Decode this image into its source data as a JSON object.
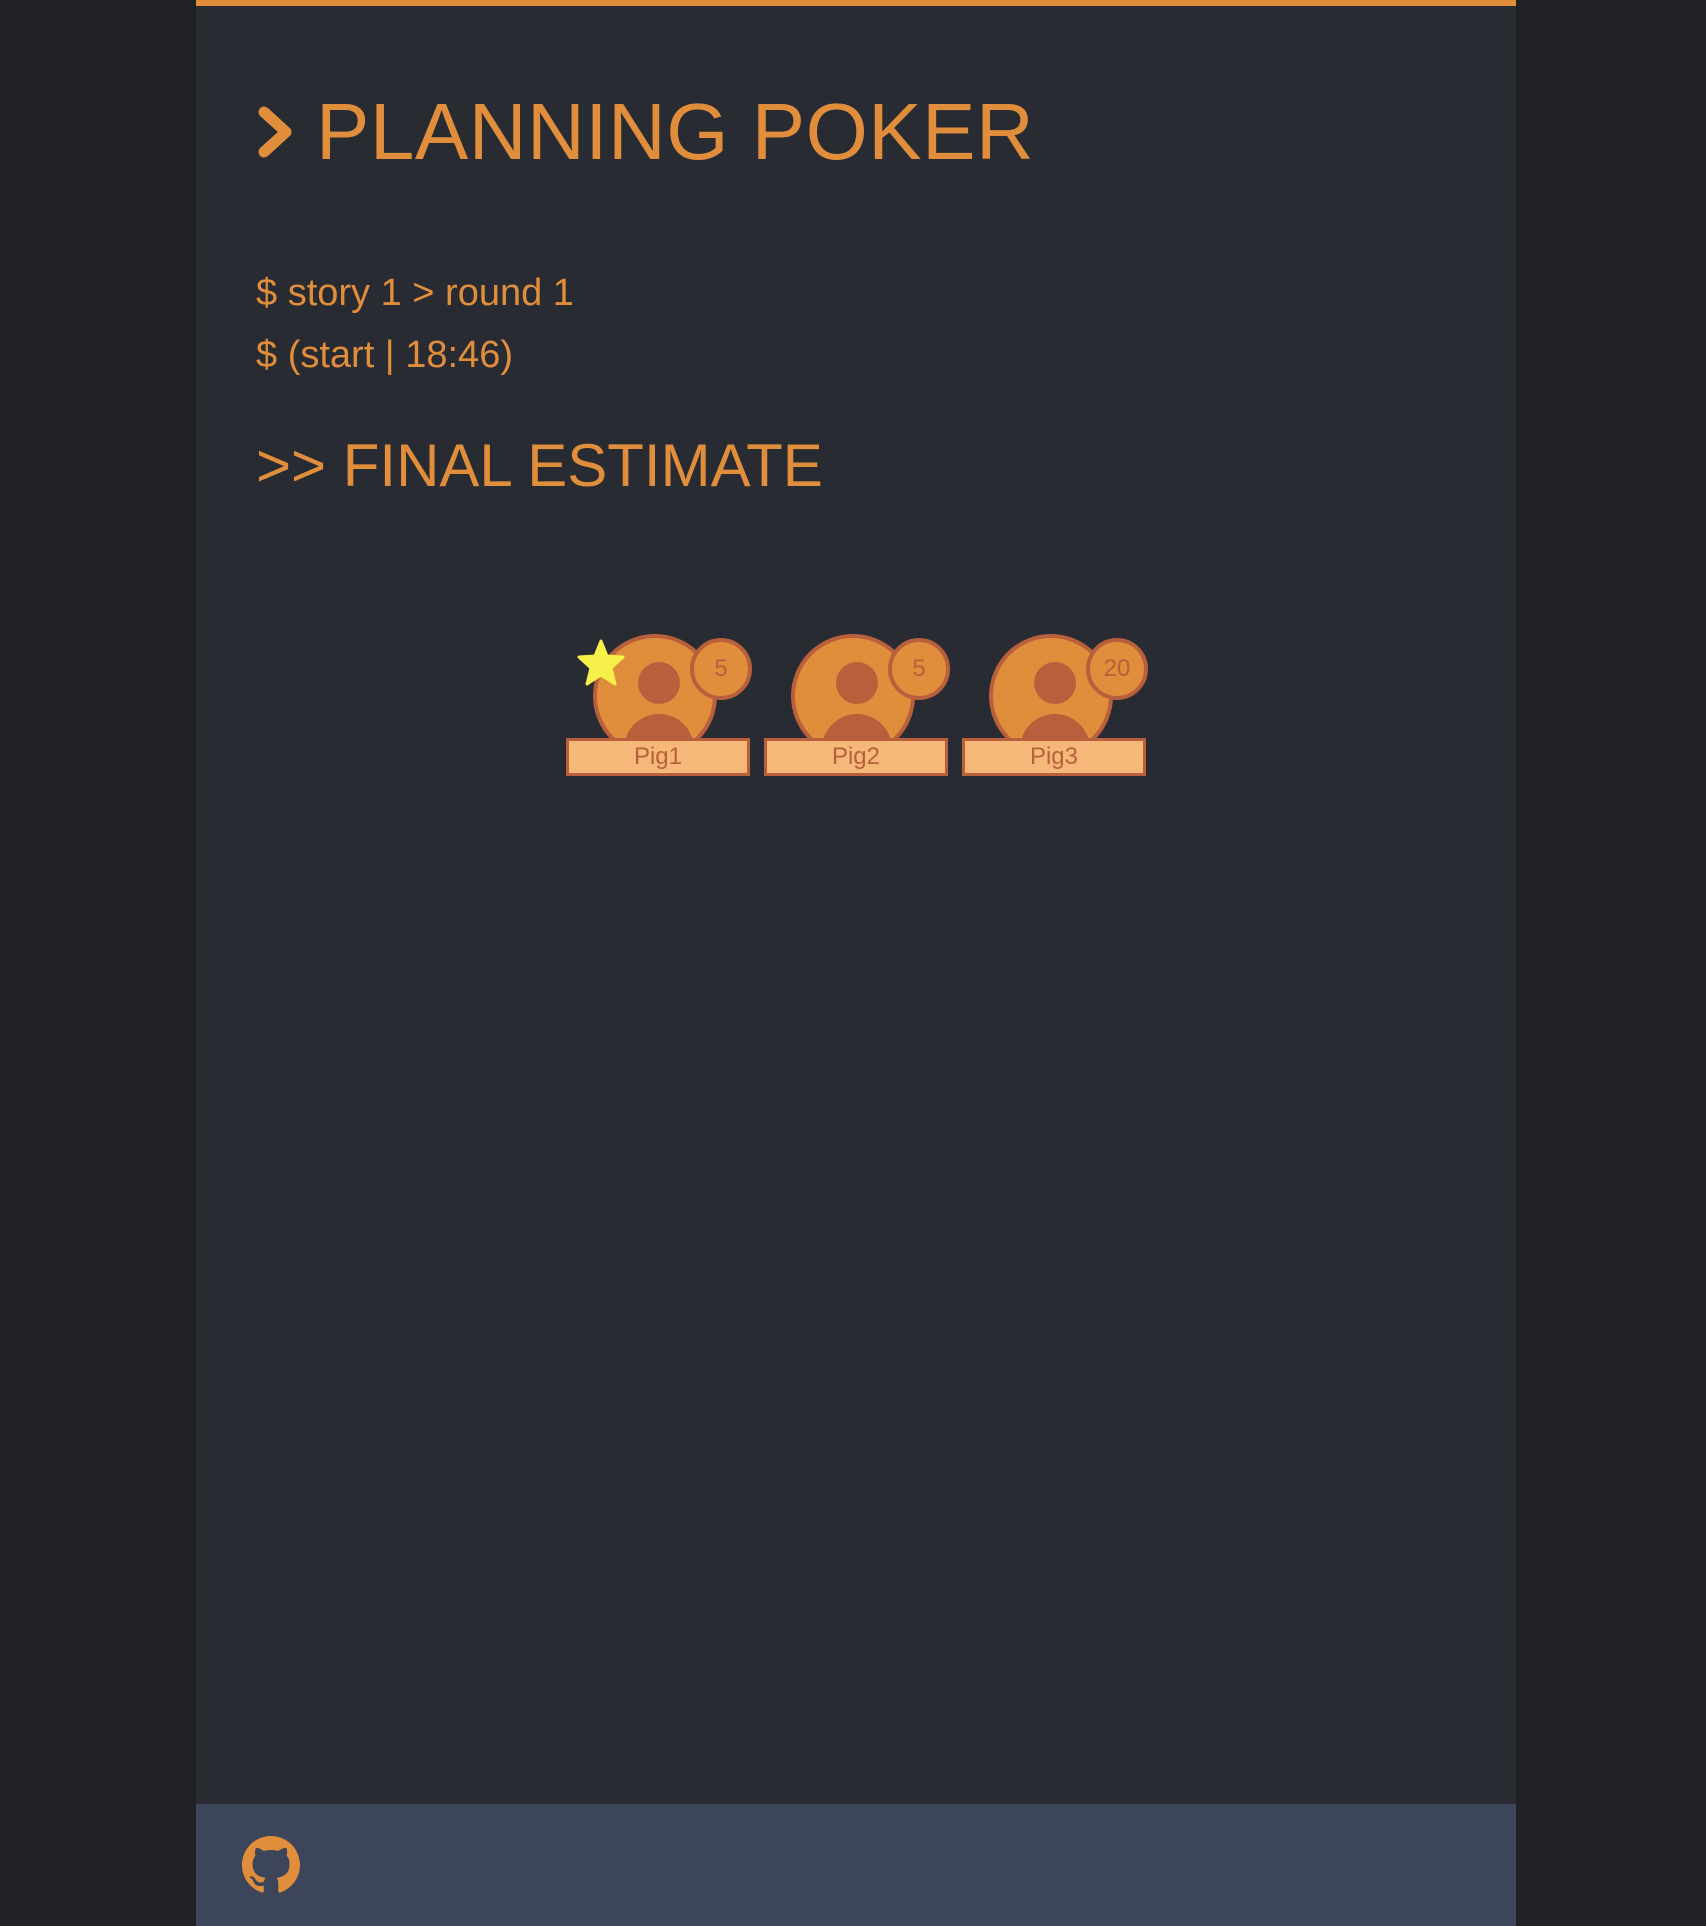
{
  "app": {
    "title": "PLANNING POKER"
  },
  "session": {
    "story_line": "$ story 1 > round 1",
    "status_line": "$ (start | 18:46)"
  },
  "estimate": {
    "heading": ">> FINAL ESTIMATE"
  },
  "players": [
    {
      "name": "Pig1",
      "vote": "5",
      "starred": true
    },
    {
      "name": "Pig2",
      "vote": "5",
      "starred": false
    },
    {
      "name": "Pig3",
      "vote": "20",
      "starred": false
    }
  ],
  "icons": {
    "header": "chevron-right-icon",
    "avatar": "user-icon",
    "highlight": "star-icon",
    "footer": "github-icon"
  },
  "colors": {
    "accent": "#e08d3c",
    "accent_dark": "#b8603c",
    "name_plate": "#f5b878",
    "star": "#f5f04a",
    "page_background": "#282b31",
    "outer_background": "#202125",
    "footer_background": "#3c4559"
  }
}
